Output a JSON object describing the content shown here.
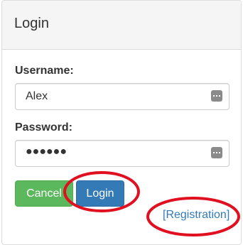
{
  "panel": {
    "title": "Login"
  },
  "form": {
    "username": {
      "label": "Username:",
      "value": "Alex"
    },
    "password": {
      "label": "Password:",
      "value": "●●●●●●"
    }
  },
  "buttons": {
    "cancel_label": "Cancel",
    "login_label": "Login"
  },
  "links": {
    "registration_label": "[Registration]"
  },
  "colors": {
    "primary": "#337ab7",
    "success": "#5cb85c",
    "annotation": "#e01020"
  }
}
